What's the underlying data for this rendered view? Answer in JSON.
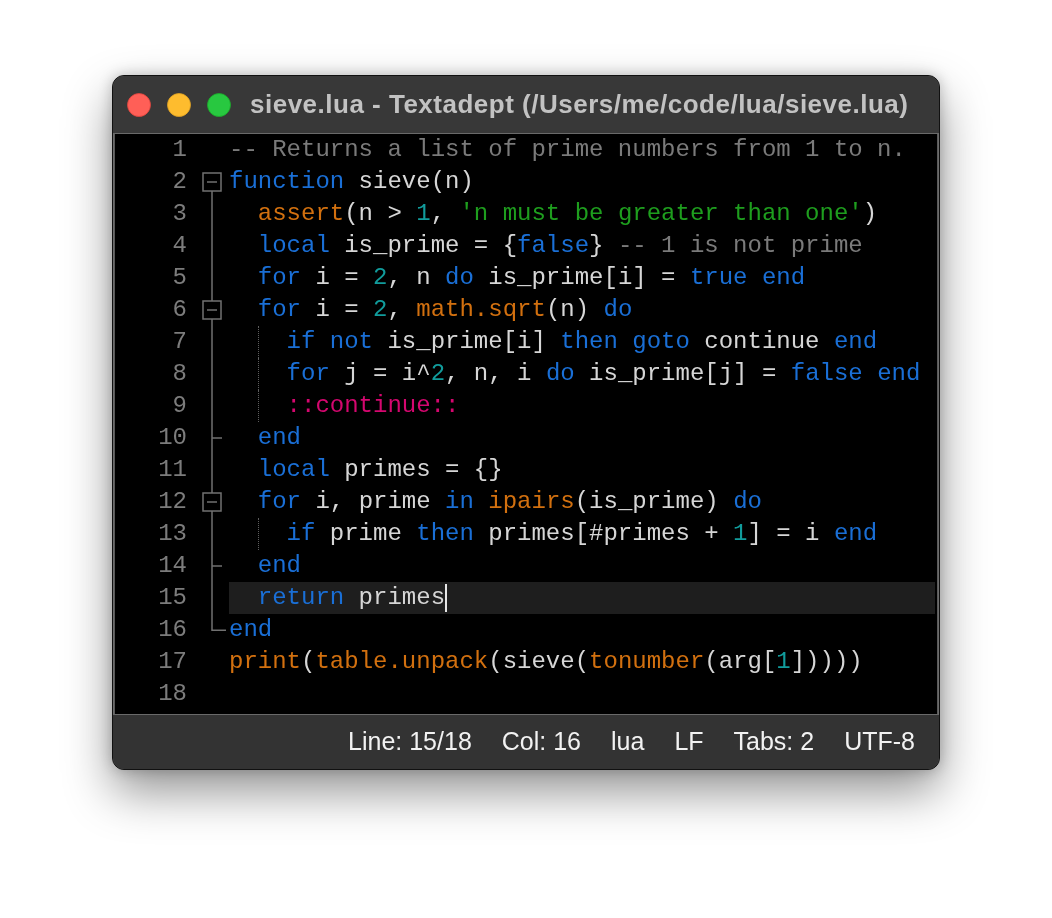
{
  "window": {
    "title": "sieve.lua - Textadept (/Users/me/code/lua/sieve.lua)"
  },
  "editor": {
    "lines": [
      {
        "number": "1",
        "kind": "plain",
        "current": false,
        "tokens": [
          {
            "kind": "comment",
            "text": "-- Returns a list of prime numbers from 1 to n."
          }
        ]
      },
      {
        "number": "2",
        "kind": "header",
        "expanded": true,
        "current": false,
        "tokens": [
          {
            "kind": "keyword",
            "text": "function"
          },
          {
            "kind": "plain",
            "text": " sieve(n)"
          }
        ],
        "children": [
          {
            "number": "3",
            "kind": "body",
            "current": false,
            "tokens": [
              {
                "kind": "function",
                "text": "assert"
              },
              {
                "kind": "plain",
                "text": "(n > "
              },
              {
                "kind": "number",
                "text": "1"
              },
              {
                "kind": "plain",
                "text": ", "
              },
              {
                "kind": "string",
                "text": "'n must be greater than one'"
              },
              {
                "kind": "plain",
                "text": ")"
              }
            ]
          },
          {
            "number": "4",
            "kind": "body",
            "current": false,
            "tokens": [
              {
                "kind": "keyword",
                "text": "local"
              },
              {
                "kind": "plain",
                "text": " is_prime = {"
              },
              {
                "kind": "keyword",
                "text": "false"
              },
              {
                "kind": "plain",
                "text": "} "
              },
              {
                "kind": "comment",
                "text": "-- 1 is not prime"
              }
            ]
          },
          {
            "number": "5",
            "kind": "body",
            "current": false,
            "tokens": [
              {
                "kind": "keyword",
                "text": "for"
              },
              {
                "kind": "plain",
                "text": " i = "
              },
              {
                "kind": "number",
                "text": "2"
              },
              {
                "kind": "plain",
                "text": ", n "
              },
              {
                "kind": "keyword",
                "text": "do"
              },
              {
                "kind": "plain",
                "text": " is_prime[i] = "
              },
              {
                "kind": "keyword",
                "text": "true "
              },
              {
                "kind": "keyword",
                "text": "end"
              }
            ]
          },
          {
            "number": "6",
            "kind": "header",
            "expanded": true,
            "current": false,
            "tokens": [
              {
                "kind": "keyword",
                "text": "for"
              },
              {
                "kind": "plain",
                "text": " i = "
              },
              {
                "kind": "number",
                "text": "2"
              },
              {
                "kind": "plain",
                "text": ", "
              },
              {
                "kind": "function",
                "text": "math.sqrt"
              },
              {
                "kind": "plain",
                "text": "(n) "
              },
              {
                "kind": "keyword",
                "text": "do"
              }
            ],
            "children": [
              {
                "number": "7",
                "kind": "body",
                "current": false,
                "tokens": [
                  {
                    "kind": "keyword",
                    "text": "if "
                  },
                  {
                    "kind": "keyword",
                    "text": "not"
                  },
                  {
                    "kind": "plain",
                    "text": " is_prime[i] "
                  },
                  {
                    "kind": "keyword",
                    "text": "then "
                  },
                  {
                    "kind": "keyword",
                    "text": "goto"
                  },
                  {
                    "kind": "plain",
                    "text": " continue "
                  },
                  {
                    "kind": "keyword",
                    "text": "end"
                  }
                ]
              },
              {
                "number": "8",
                "kind": "body",
                "current": false,
                "tokens": [
                  {
                    "kind": "keyword",
                    "text": "for"
                  },
                  {
                    "kind": "plain",
                    "text": " j = i^"
                  },
                  {
                    "kind": "number",
                    "text": "2"
                  },
                  {
                    "kind": "plain",
                    "text": ", n, i "
                  },
                  {
                    "kind": "keyword",
                    "text": "do"
                  },
                  {
                    "kind": "plain",
                    "text": " is_prime[j] = "
                  },
                  {
                    "kind": "keyword",
                    "text": "false "
                  },
                  {
                    "kind": "keyword",
                    "text": "end"
                  }
                ]
              },
              {
                "number": "9",
                "kind": "body",
                "current": false,
                "tokens": [
                  {
                    "kind": "label",
                    "text": "::continue::"
                  }
                ]
              }
            ]
          },
          {
            "number": "10",
            "kind": "tail",
            "current": false,
            "tokens": [
              {
                "kind": "keyword",
                "text": "end"
              }
            ]
          },
          {
            "number": "11",
            "kind": "body",
            "current": false,
            "tokens": [
              {
                "kind": "keyword",
                "text": "local"
              },
              {
                "kind": "plain",
                "text": " primes = {}"
              }
            ]
          },
          {
            "number": "12",
            "kind": "header",
            "expanded": true,
            "current": false,
            "tokens": [
              {
                "kind": "keyword",
                "text": "for"
              },
              {
                "kind": "plain",
                "text": " i, prime "
              },
              {
                "kind": "keyword",
                "text": "in "
              },
              {
                "kind": "function",
                "text": "ipairs"
              },
              {
                "kind": "plain",
                "text": "(is_prime) "
              },
              {
                "kind": "keyword",
                "text": "do"
              }
            ],
            "children": [
              {
                "number": "13",
                "kind": "body",
                "current": false,
                "tokens": [
                  {
                    "kind": "keyword",
                    "text": "if"
                  },
                  {
                    "kind": "plain",
                    "text": " prime "
                  },
                  {
                    "kind": "keyword",
                    "text": "then"
                  },
                  {
                    "kind": "plain",
                    "text": " primes[#primes + "
                  },
                  {
                    "kind": "number",
                    "text": "1"
                  },
                  {
                    "kind": "plain",
                    "text": "] = i "
                  },
                  {
                    "kind": "keyword",
                    "text": "end"
                  }
                ]
              }
            ]
          },
          {
            "number": "14",
            "kind": "tail",
            "current": false,
            "tokens": [
              {
                "kind": "keyword",
                "text": "end"
              }
            ]
          },
          {
            "number": "15",
            "kind": "body",
            "current": true,
            "tokens": [
              {
                "kind": "keyword",
                "text": "return"
              },
              {
                "kind": "plain",
                "text": " primes"
              }
            ]
          }
        ]
      },
      {
        "number": "16",
        "kind": "footer",
        "current": false,
        "tokens": [
          {
            "kind": "keyword",
            "text": "end"
          }
        ]
      },
      {
        "number": "17",
        "kind": "plain",
        "current": false,
        "tokens": [
          {
            "kind": "function",
            "text": "print"
          },
          {
            "kind": "plain",
            "text": "("
          },
          {
            "kind": "function",
            "text": "table.unpack"
          },
          {
            "kind": "plain",
            "text": "(sieve("
          },
          {
            "kind": "function",
            "text": "tonumber"
          },
          {
            "kind": "plain",
            "text": "(arg["
          },
          {
            "kind": "number",
            "text": "1"
          },
          {
            "kind": "plain",
            "text": "]))))"
          }
        ]
      },
      {
        "number": "18",
        "kind": "plain",
        "current": false
      }
    ]
  },
  "status_bar": {
    "items": [
      "Line: 15/18",
      "Col: 16",
      "lua",
      "LF",
      "Tabs: 2",
      "UTF-8"
    ]
  }
}
